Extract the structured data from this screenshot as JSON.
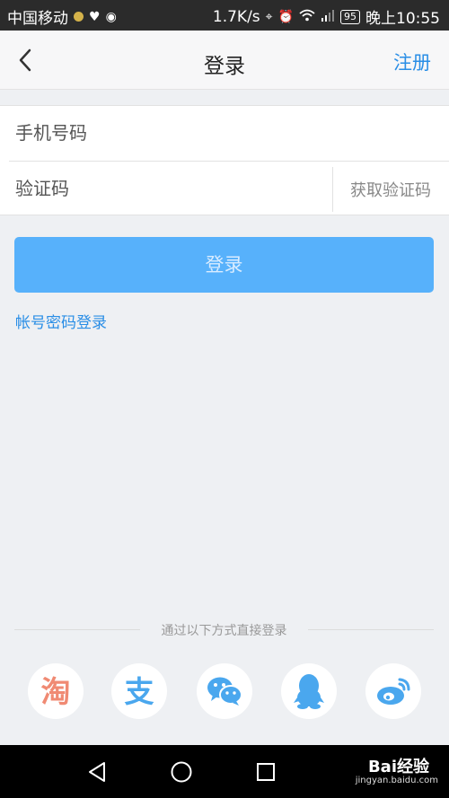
{
  "status_bar": {
    "carrier": "中国移动",
    "speed": "1.7K/s",
    "battery": "95",
    "time": "晚上10:55"
  },
  "nav": {
    "title": "登录",
    "register_label": "注册"
  },
  "form": {
    "phone_placeholder": "手机号码",
    "code_placeholder": "验证码",
    "get_code_label": "获取验证码"
  },
  "login_button_label": "登录",
  "password_login_link": "帐号密码登录",
  "third_party": {
    "divider_text": "通过以下方式直接登录",
    "providers": [
      {
        "name": "taobao",
        "glyph": "淘",
        "color": "#f08a73"
      },
      {
        "name": "alipay",
        "glyph": "支",
        "color": "#4aa7ee"
      },
      {
        "name": "wechat",
        "color": "#4aa7ee"
      },
      {
        "name": "qq",
        "color": "#4aa7ee"
      },
      {
        "name": "weibo",
        "color": "#4aa7ee"
      }
    ]
  },
  "watermark": {
    "brand": "Bai经验",
    "url": "jingyan.baidu.com"
  },
  "colors": {
    "accent": "#2a8ee6",
    "login_button": "#57b1fb",
    "background": "#eef0f3"
  }
}
